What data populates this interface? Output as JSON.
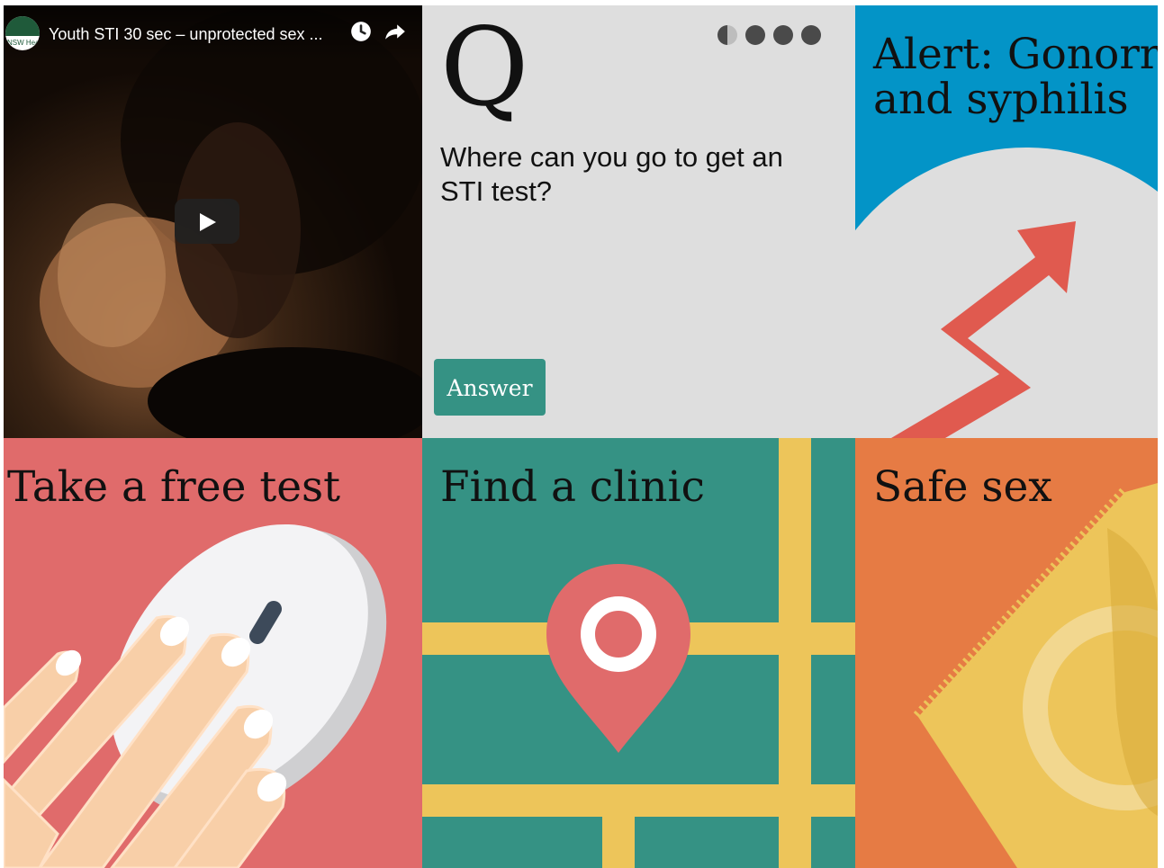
{
  "video": {
    "channel_text": "NSW Health",
    "title": "Youth STI 30 sec – unprotected sex ...",
    "icons": [
      "watch-later-icon",
      "share-icon",
      "play-icon"
    ]
  },
  "question": {
    "letter": "Q",
    "text": "Where can you go to get an STI test?",
    "answer_label": "Answer",
    "pager_count": 4,
    "pager_current": 1
  },
  "alert": {
    "title_line1": "Alert: Gonorrh",
    "title_line2": "and syphilis"
  },
  "tiles": {
    "test": "Take a free test",
    "clinic": "Find a clinic",
    "safe": "Safe sex"
  },
  "colors": {
    "teal": "#359284",
    "coral": "#e06b6b",
    "orange": "#e67b44",
    "blue": "#0394c7",
    "grey": "#dedede",
    "yellow": "#edc55a",
    "arrow_red": "#e05a4f"
  }
}
